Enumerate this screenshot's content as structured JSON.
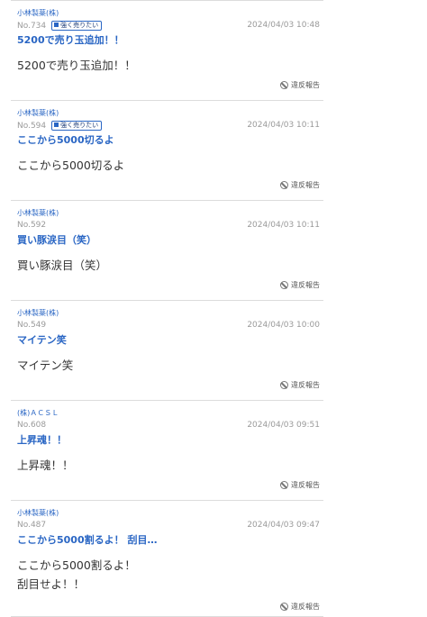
{
  "posts": [
    {
      "company": "小林製薬(株)",
      "no": "No.734",
      "badge": "強く売りたい",
      "date": "2024/04/03 10:48",
      "title": "5200で売り玉追加！！",
      "body": "5200で売り玉追加！！",
      "report": "違反報告"
    },
    {
      "company": "小林製薬(株)",
      "no": "No.594",
      "badge": "強く売りたい",
      "date": "2024/04/03 10:11",
      "title": "ここから5000切るよ",
      "body": "ここから5000切るよ",
      "report": "違反報告"
    },
    {
      "company": "小林製薬(株)",
      "no": "No.592",
      "badge": "",
      "date": "2024/04/03 10:11",
      "title": "買い豚涙目（笑）",
      "body": "買い豚涙目（笑）",
      "report": "違反報告"
    },
    {
      "company": "小林製薬(株)",
      "no": "No.549",
      "badge": "",
      "date": "2024/04/03 10:00",
      "title": "マイテン笑",
      "body": "マイテン笑",
      "report": "違反報告"
    },
    {
      "company": "(株)ＡＣＳＬ",
      "no": "No.608",
      "badge": "",
      "date": "2024/04/03 09:51",
      "title": "上昇魂！！",
      "body": "上昇魂！！",
      "report": "違反報告"
    },
    {
      "company": "小林製薬(株)",
      "no": "No.487",
      "badge": "",
      "date": "2024/04/03 09:47",
      "title": "ここから5000割るよ！ 刮目…",
      "body": "ここから5000割るよ！\n刮目せよ！！",
      "report": "違反報告"
    }
  ]
}
